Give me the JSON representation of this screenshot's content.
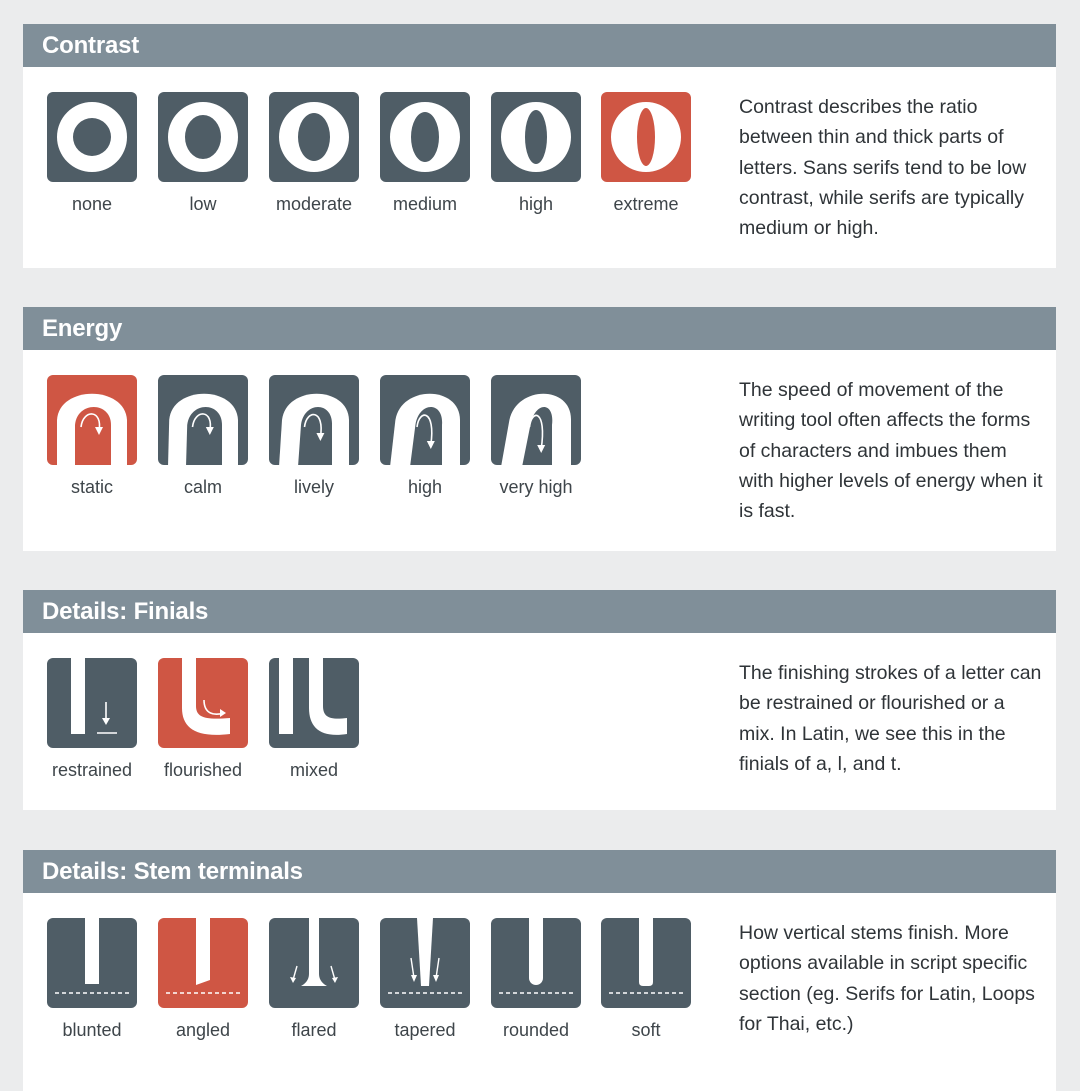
{
  "colors": {
    "tile": "#4f5d66",
    "accent": "#cf5644",
    "header": "#808f99"
  },
  "sections": [
    {
      "title": "Contrast",
      "items": [
        {
          "label": "none",
          "icon": "contrast-none-icon",
          "highlight": false
        },
        {
          "label": "low",
          "icon": "contrast-low-icon",
          "highlight": false
        },
        {
          "label": "moderate",
          "icon": "contrast-moderate-icon",
          "highlight": false
        },
        {
          "label": "medium",
          "icon": "contrast-medium-icon",
          "highlight": false
        },
        {
          "label": "high",
          "icon": "contrast-high-icon",
          "highlight": false
        },
        {
          "label": "extreme",
          "icon": "contrast-extreme-icon",
          "highlight": true
        }
      ],
      "description": "Contrast describes the ratio between thin and thick parts of letters. Sans serifs tend to be low contrast, while serifs are typically medium or high."
    },
    {
      "title": "Energy",
      "items": [
        {
          "label": "static",
          "icon": "energy-static-icon",
          "highlight": true
        },
        {
          "label": "calm",
          "icon": "energy-calm-icon",
          "highlight": false
        },
        {
          "label": "lively",
          "icon": "energy-lively-icon",
          "highlight": false
        },
        {
          "label": "high",
          "icon": "energy-high-icon",
          "highlight": false
        },
        {
          "label": "very high",
          "icon": "energy-very-high-icon",
          "highlight": false
        }
      ],
      "description": "The speed of movement of the writing tool often affects the forms of characters and imbues them with higher levels of energy when it is fast."
    },
    {
      "title": "Details: Finials",
      "items": [
        {
          "label": "restrained",
          "icon": "finial-restrained-icon",
          "highlight": false
        },
        {
          "label": "flourished",
          "icon": "finial-flourished-icon",
          "highlight": true
        },
        {
          "label": "mixed",
          "icon": "finial-mixed-icon",
          "highlight": false
        }
      ],
      "description": "The finishing strokes of a letter can be restrained or flourished or a mix. In Latin, we see this in the finials of a, l, and t."
    },
    {
      "title": "Details: Stem terminals",
      "items": [
        {
          "label": "blunted",
          "icon": "stem-blunted-icon",
          "highlight": false
        },
        {
          "label": "angled",
          "icon": "stem-angled-icon",
          "highlight": true
        },
        {
          "label": "flared",
          "icon": "stem-flared-icon",
          "highlight": false
        },
        {
          "label": "tapered",
          "icon": "stem-tapered-icon",
          "highlight": false
        },
        {
          "label": "rounded",
          "icon": "stem-rounded-icon",
          "highlight": false
        },
        {
          "label": "soft",
          "icon": "stem-soft-icon",
          "highlight": false
        }
      ],
      "description": "How vertical stems finish. More options available in script specific section (eg. Serifs for Latin, Loops for Thai, etc.)"
    }
  ]
}
